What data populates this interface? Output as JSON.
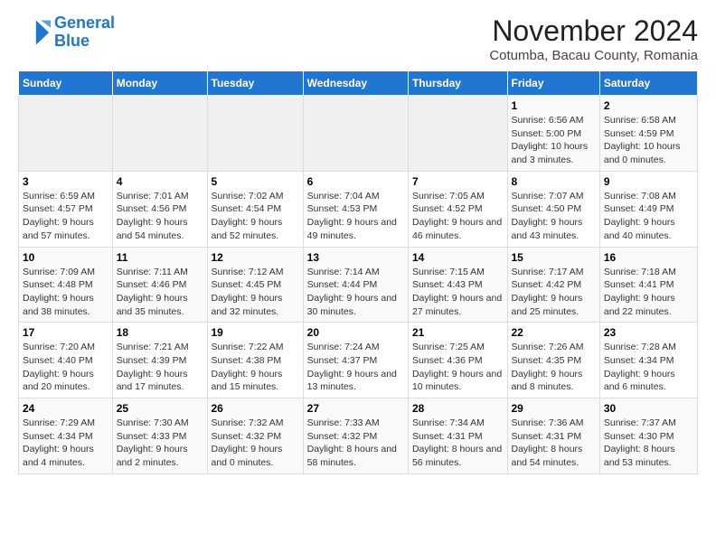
{
  "header": {
    "logo_line1": "General",
    "logo_line2": "Blue",
    "title": "November 2024",
    "subtitle": "Cotumba, Bacau County, Romania"
  },
  "days_of_week": [
    "Sunday",
    "Monday",
    "Tuesday",
    "Wednesday",
    "Thursday",
    "Friday",
    "Saturday"
  ],
  "weeks": [
    [
      {
        "day": "",
        "info": ""
      },
      {
        "day": "",
        "info": ""
      },
      {
        "day": "",
        "info": ""
      },
      {
        "day": "",
        "info": ""
      },
      {
        "day": "",
        "info": ""
      },
      {
        "day": "1",
        "info": "Sunrise: 6:56 AM\nSunset: 5:00 PM\nDaylight: 10 hours and 3 minutes."
      },
      {
        "day": "2",
        "info": "Sunrise: 6:58 AM\nSunset: 4:59 PM\nDaylight: 10 hours and 0 minutes."
      }
    ],
    [
      {
        "day": "3",
        "info": "Sunrise: 6:59 AM\nSunset: 4:57 PM\nDaylight: 9 hours and 57 minutes."
      },
      {
        "day": "4",
        "info": "Sunrise: 7:01 AM\nSunset: 4:56 PM\nDaylight: 9 hours and 54 minutes."
      },
      {
        "day": "5",
        "info": "Sunrise: 7:02 AM\nSunset: 4:54 PM\nDaylight: 9 hours and 52 minutes."
      },
      {
        "day": "6",
        "info": "Sunrise: 7:04 AM\nSunset: 4:53 PM\nDaylight: 9 hours and 49 minutes."
      },
      {
        "day": "7",
        "info": "Sunrise: 7:05 AM\nSunset: 4:52 PM\nDaylight: 9 hours and 46 minutes."
      },
      {
        "day": "8",
        "info": "Sunrise: 7:07 AM\nSunset: 4:50 PM\nDaylight: 9 hours and 43 minutes."
      },
      {
        "day": "9",
        "info": "Sunrise: 7:08 AM\nSunset: 4:49 PM\nDaylight: 9 hours and 40 minutes."
      }
    ],
    [
      {
        "day": "10",
        "info": "Sunrise: 7:09 AM\nSunset: 4:48 PM\nDaylight: 9 hours and 38 minutes."
      },
      {
        "day": "11",
        "info": "Sunrise: 7:11 AM\nSunset: 4:46 PM\nDaylight: 9 hours and 35 minutes."
      },
      {
        "day": "12",
        "info": "Sunrise: 7:12 AM\nSunset: 4:45 PM\nDaylight: 9 hours and 32 minutes."
      },
      {
        "day": "13",
        "info": "Sunrise: 7:14 AM\nSunset: 4:44 PM\nDaylight: 9 hours and 30 minutes."
      },
      {
        "day": "14",
        "info": "Sunrise: 7:15 AM\nSunset: 4:43 PM\nDaylight: 9 hours and 27 minutes."
      },
      {
        "day": "15",
        "info": "Sunrise: 7:17 AM\nSunset: 4:42 PM\nDaylight: 9 hours and 25 minutes."
      },
      {
        "day": "16",
        "info": "Sunrise: 7:18 AM\nSunset: 4:41 PM\nDaylight: 9 hours and 22 minutes."
      }
    ],
    [
      {
        "day": "17",
        "info": "Sunrise: 7:20 AM\nSunset: 4:40 PM\nDaylight: 9 hours and 20 minutes."
      },
      {
        "day": "18",
        "info": "Sunrise: 7:21 AM\nSunset: 4:39 PM\nDaylight: 9 hours and 17 minutes."
      },
      {
        "day": "19",
        "info": "Sunrise: 7:22 AM\nSunset: 4:38 PM\nDaylight: 9 hours and 15 minutes."
      },
      {
        "day": "20",
        "info": "Sunrise: 7:24 AM\nSunset: 4:37 PM\nDaylight: 9 hours and 13 minutes."
      },
      {
        "day": "21",
        "info": "Sunrise: 7:25 AM\nSunset: 4:36 PM\nDaylight: 9 hours and 10 minutes."
      },
      {
        "day": "22",
        "info": "Sunrise: 7:26 AM\nSunset: 4:35 PM\nDaylight: 9 hours and 8 minutes."
      },
      {
        "day": "23",
        "info": "Sunrise: 7:28 AM\nSunset: 4:34 PM\nDaylight: 9 hours and 6 minutes."
      }
    ],
    [
      {
        "day": "24",
        "info": "Sunrise: 7:29 AM\nSunset: 4:34 PM\nDaylight: 9 hours and 4 minutes."
      },
      {
        "day": "25",
        "info": "Sunrise: 7:30 AM\nSunset: 4:33 PM\nDaylight: 9 hours and 2 minutes."
      },
      {
        "day": "26",
        "info": "Sunrise: 7:32 AM\nSunset: 4:32 PM\nDaylight: 9 hours and 0 minutes."
      },
      {
        "day": "27",
        "info": "Sunrise: 7:33 AM\nSunset: 4:32 PM\nDaylight: 8 hours and 58 minutes."
      },
      {
        "day": "28",
        "info": "Sunrise: 7:34 AM\nSunset: 4:31 PM\nDaylight: 8 hours and 56 minutes."
      },
      {
        "day": "29",
        "info": "Sunrise: 7:36 AM\nSunset: 4:31 PM\nDaylight: 8 hours and 54 minutes."
      },
      {
        "day": "30",
        "info": "Sunrise: 7:37 AM\nSunset: 4:30 PM\nDaylight: 8 hours and 53 minutes."
      }
    ]
  ]
}
